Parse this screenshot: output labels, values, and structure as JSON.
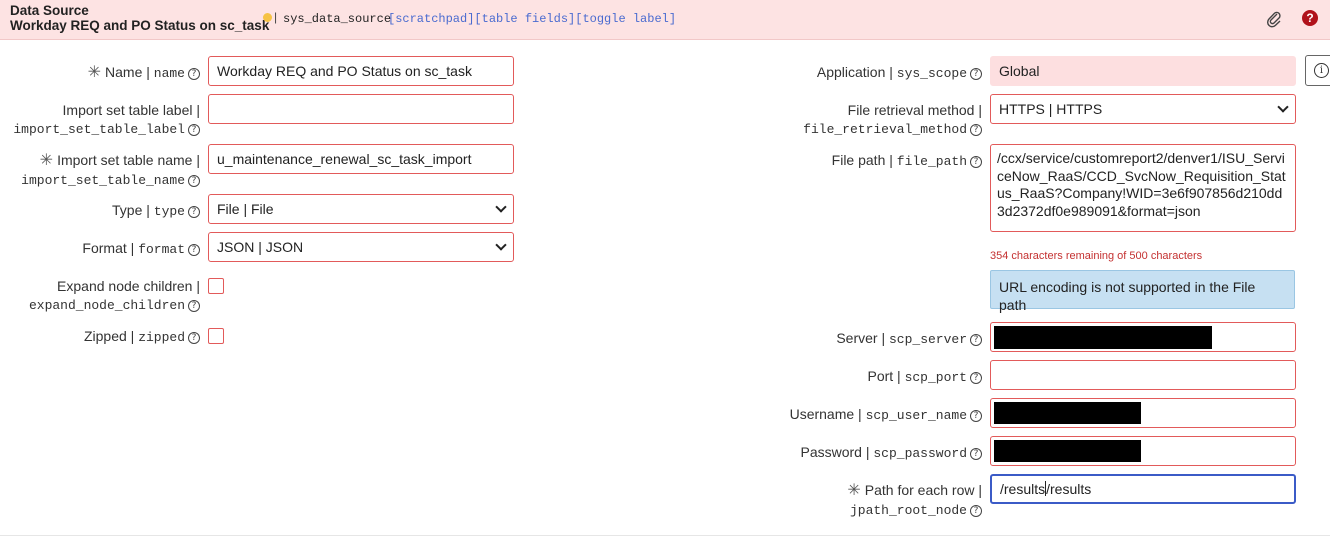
{
  "header": {
    "title": "Data Source",
    "record_name": "Workday REQ and PO Status on sc_task",
    "table_name": "sys_data_source",
    "links": [
      "[scratchpad]",
      "[table fields]",
      "[toggle label]"
    ]
  },
  "left_fields": {
    "name": {
      "label": "Name | ",
      "field": "name",
      "value": "Workday REQ and PO Status on sc_task"
    },
    "import_label": {
      "label": "Import set table label |",
      "field": "import_set_table_label",
      "value": ""
    },
    "import_name": {
      "label": "Import set table name |",
      "field": "import_set_table_name",
      "value": "u_maintenance_renewal_sc_task_import"
    },
    "type": {
      "label": "Type | ",
      "field": "type",
      "value": "File | File"
    },
    "format": {
      "label": "Format | ",
      "field": "format",
      "value": "JSON | JSON"
    },
    "expand": {
      "label": "Expand node children |",
      "field": "expand_node_children",
      "checked": false
    },
    "zipped": {
      "label": "Zipped | ",
      "field": "zipped",
      "checked": false
    }
  },
  "right_fields": {
    "application": {
      "label": "Application | ",
      "field": "sys_scope",
      "value": "Global"
    },
    "retrieval": {
      "label": "File retrieval method |",
      "field": "file_retrieval_method",
      "value": "HTTPS | HTTPS"
    },
    "file_path": {
      "label": "File path | ",
      "field": "file_path",
      "value": "/ccx/service/customreport2/denver1/ISU_ServiceNow_RaaS/CCD_SvcNow_Requisition_Status_RaaS?Company!WID=3e6f907856d210dd3d2372df0e989091&format=json",
      "counter": "354 characters remaining of 500 characters",
      "note": "URL encoding is not supported in the File path"
    },
    "server": {
      "label": "Server | ",
      "field": "scp_server"
    },
    "port": {
      "label": "Port | ",
      "field": "scp_port",
      "value": ""
    },
    "username": {
      "label": "Username | ",
      "field": "scp_user_name"
    },
    "password": {
      "label": "Password | ",
      "field": "scp_password"
    },
    "path_row": {
      "label": "Path for each row |",
      "field": "jpath_root_node",
      "value_before_cursor": "/results",
      "value_after_cursor": "/results"
    }
  },
  "icons": {
    "attachment": "paperclip-icon",
    "help": "help-icon",
    "info": "info-icon",
    "required": "asterisk-icon",
    "field_help": "question-circle-icon"
  },
  "colors": {
    "header_bg": "#fde3e3",
    "mandatory_border": "#e25a5a",
    "info_bg": "#c6e0f2",
    "link": "#4a6bd0",
    "focus": "#3b5bc7"
  }
}
